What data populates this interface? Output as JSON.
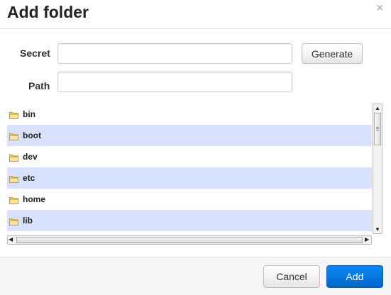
{
  "dialog": {
    "title": "Add folder",
    "close_symbol": "×"
  },
  "form": {
    "secret_label": "Secret",
    "secret_value": "",
    "path_label": "Path",
    "path_value": "",
    "generate_label": "Generate"
  },
  "tree": {
    "items": [
      {
        "label": "bin",
        "icon": "folder-icon",
        "highlighted": false
      },
      {
        "label": "boot",
        "icon": "folder-icon",
        "highlighted": true
      },
      {
        "label": "dev",
        "icon": "folder-icon",
        "highlighted": false
      },
      {
        "label": "etc",
        "icon": "folder-icon",
        "highlighted": true
      },
      {
        "label": "home",
        "icon": "folder-icon",
        "highlighted": false
      },
      {
        "label": "lib",
        "icon": "folder-icon",
        "highlighted": true
      }
    ],
    "highlight_color": "#d8e2fc"
  },
  "footer": {
    "cancel_label": "Cancel",
    "add_label": "Add",
    "add_color": "#0a7cee"
  }
}
